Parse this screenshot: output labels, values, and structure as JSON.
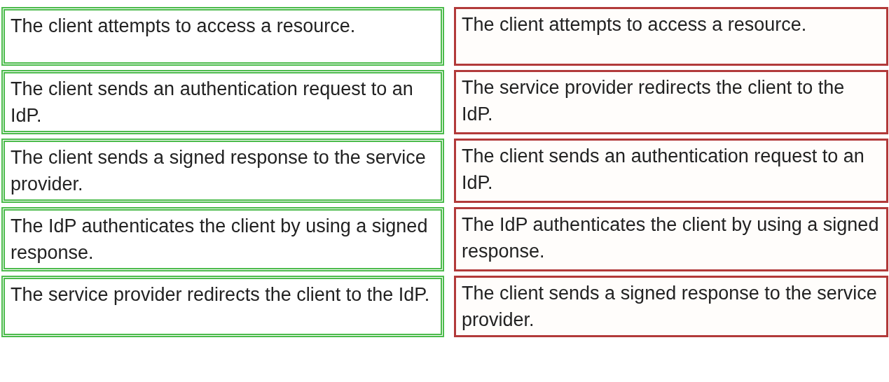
{
  "steps": [
    {
      "text": "The client attempts to access a resource."
    },
    {
      "text": "The client sends an authentication request to an IdP."
    },
    {
      "text": "The client sends a signed response to the service provider."
    },
    {
      "text": "The IdP authenticates the client by using a signed response."
    },
    {
      "text": "The service provider redirects the client to the IdP."
    }
  ],
  "answer_area": [
    {
      "text": "The client attempts to access a resource."
    },
    {
      "text": "The service provider redirects the client to the IdP."
    },
    {
      "text": "The client sends an authentication request to an IdP."
    },
    {
      "text": "The IdP authenticates the client by using a signed response."
    },
    {
      "text": "The client sends a signed response to the service provider."
    }
  ]
}
